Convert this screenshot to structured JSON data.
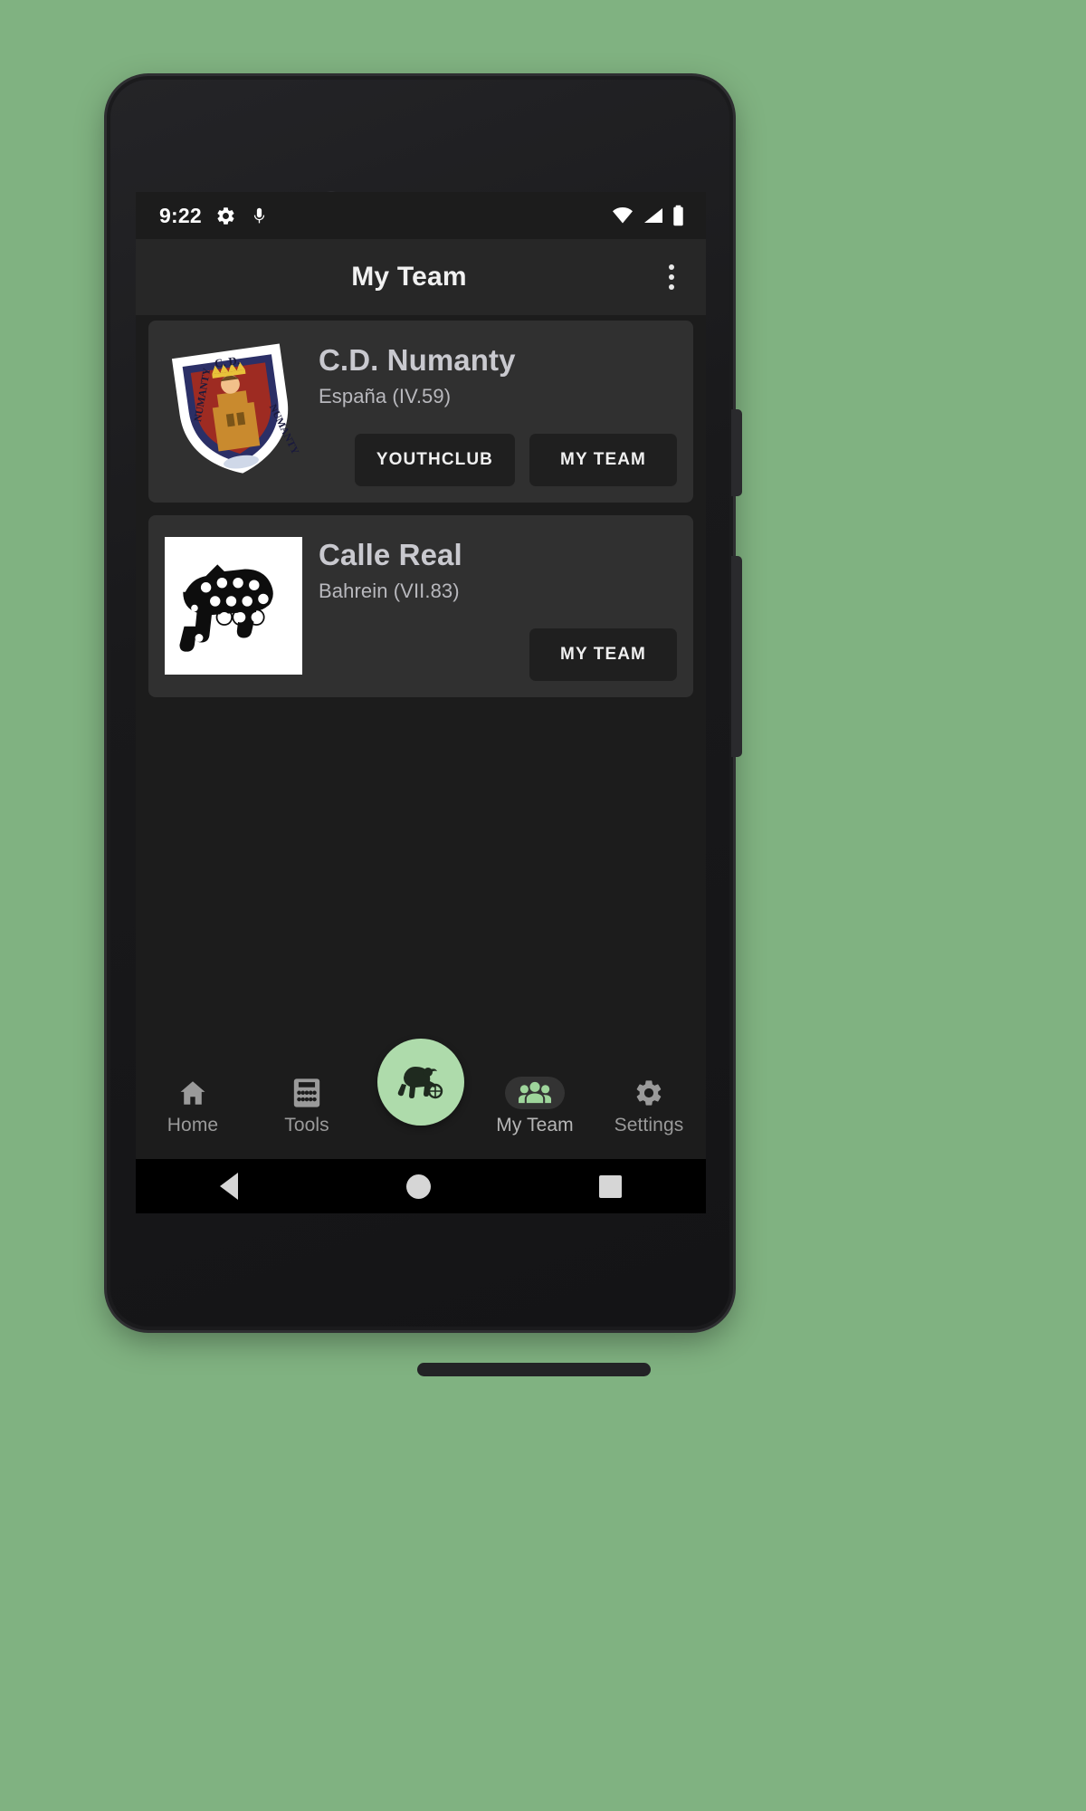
{
  "status_bar": {
    "time": "9:22",
    "left_icons": [
      "gear-icon",
      "microphone-icon"
    ],
    "right_icons": [
      "wifi-icon",
      "cellular-signal-icon",
      "battery-icon"
    ]
  },
  "app_bar": {
    "title": "My Team",
    "overflow_icon": "more-vertical-icon"
  },
  "teams": [
    {
      "name": "C.D. Numanty",
      "meta": "España (IV.59)",
      "crest": "numanty-shield-crest",
      "buttons": [
        {
          "label": "YOUTHCLUB",
          "wide": true
        },
        {
          "label": "MY TEAM",
          "wide": true
        }
      ]
    },
    {
      "name": "Calle Real",
      "meta": "Bahrein (VII.83)",
      "crest": "calle-real-horse-logo",
      "buttons": [
        {
          "label": "MY TEAM",
          "wide": true
        }
      ]
    }
  ],
  "bottom_nav": {
    "items": [
      {
        "label": "Home",
        "icon": "home-icon",
        "active": false
      },
      {
        "label": "Tools",
        "icon": "calculator-icon",
        "active": false
      },
      {
        "label": "My Team",
        "icon": "people-group-icon",
        "active": true
      },
      {
        "label": "Settings",
        "icon": "gear-icon",
        "active": false
      }
    ],
    "fab": {
      "icon": "monkey-with-ball-icon"
    }
  },
  "system_nav": {
    "back": "back-triangle-icon",
    "home": "home-circle-icon",
    "recents": "recents-square-icon"
  },
  "colors": {
    "background": "#80b281",
    "screen_bg": "#1c1c1c",
    "app_bar_bg": "#272727",
    "card_bg": "#303030",
    "accent_green": "#aedbab",
    "button_bg": "#1f1f1f"
  }
}
